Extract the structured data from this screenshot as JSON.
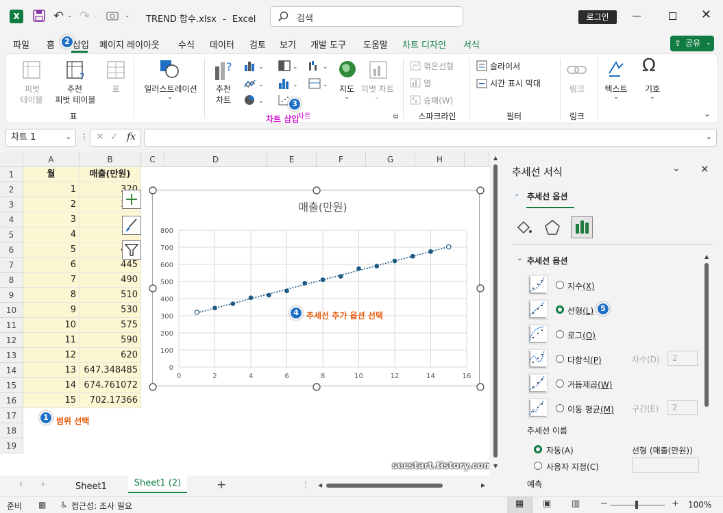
{
  "titlebar": {
    "filename": "TREND 함수.xlsx",
    "separator": "-",
    "app": "Excel",
    "search_placeholder": "검색",
    "login": "로그인"
  },
  "menu": {
    "tabs": [
      "파일",
      "홈",
      "삽입",
      "페이지 레이아웃",
      "수식",
      "데이터",
      "검토",
      "보기",
      "개발 도구",
      "도움말",
      "차트 디자인",
      "서식"
    ],
    "share": "공유"
  },
  "ribbon": {
    "pivot_table": [
      "피벗",
      "테이블"
    ],
    "recommended_pivot": [
      "추천",
      "피벗 테이블"
    ],
    "table": "표",
    "group_table": "표",
    "illustrations": "일러스트레이션",
    "recommended_chart": [
      "추천",
      "차트"
    ],
    "map": "지도",
    "pivot_chart": "피벗 차트",
    "group_chart": "차트",
    "sparkline_line": "꺾은선형",
    "sparkline_column": "열",
    "sparkline_winloss": "승패(W)",
    "group_sparkline": "스파크라인",
    "slicer": "슬라이서",
    "timeline": "시간 표시 막대",
    "group_filter": "필터",
    "link": "링크",
    "group_link": "링크",
    "text": "텍스트",
    "symbol": "기호"
  },
  "formula_bar": {
    "name_box": "차트 1",
    "fx": "fx",
    "formula": ""
  },
  "sheet": {
    "columns": [
      "A",
      "B",
      "C",
      "D",
      "E",
      "F",
      "G",
      "H"
    ],
    "rows": [
      "1",
      "2",
      "3",
      "4",
      "5",
      "6",
      "7",
      "8",
      "9",
      "10",
      "11",
      "12",
      "13",
      "14",
      "15",
      "16",
      "17",
      "18",
      "19"
    ],
    "header_a": "월",
    "header_b": "매출(만원)",
    "months": [
      "1",
      "2",
      "3",
      "4",
      "5",
      "6",
      "7",
      "8",
      "9",
      "10",
      "11",
      "12",
      "13",
      "14",
      "15"
    ],
    "sales": [
      "320",
      "345",
      "",
      "",
      "410",
      "445",
      "490",
      "510",
      "530",
      "575",
      "590",
      "620",
      "647.348485",
      "674.761072",
      "702.17366"
    ]
  },
  "chart_data": {
    "type": "scatter",
    "title": "매출(만원)",
    "x": [
      1,
      2,
      3,
      4,
      5,
      6,
      7,
      8,
      9,
      10,
      11,
      12,
      13,
      14,
      15
    ],
    "y": [
      320,
      345,
      370,
      405,
      420,
      445,
      490,
      510,
      530,
      575,
      590,
      620,
      647.35,
      674.76,
      702.17
    ],
    "xlim": [
      0,
      16
    ],
    "ylim": [
      0,
      800
    ],
    "x_ticks": [
      "0",
      "2",
      "4",
      "6",
      "8",
      "10",
      "12",
      "14",
      "16"
    ],
    "y_ticks": [
      "0",
      "100",
      "200",
      "300",
      "400",
      "500",
      "600",
      "700",
      "800"
    ],
    "trendline": "linear",
    "grid": true,
    "colors": {
      "marker": "#1f5b85",
      "trend": "#1f5b85"
    }
  },
  "annotations": {
    "a1": {
      "num": "1",
      "text": "범위 선택"
    },
    "a2": {
      "num": "2"
    },
    "a3": {
      "num": "3",
      "text": "차트 삽입"
    },
    "a4": {
      "num": "4",
      "text": "추세선 추가 옵션 선택"
    },
    "a5": {
      "num": "5"
    },
    "watermark": "secstart.tistory.com"
  },
  "pane": {
    "title": "추세선 서식",
    "tab": "추세선 옵션",
    "section": "추세선 옵션",
    "options": [
      {
        "label": "지수",
        "key": "(X)"
      },
      {
        "label": "선형",
        "key": "(L)"
      },
      {
        "label": "로그",
        "key": "(O)"
      },
      {
        "label": "다항식",
        "key": "(P)"
      },
      {
        "label": "거듭제곱",
        "key": "(W)"
      },
      {
        "label": "이동 평균",
        "key": "(M)"
      }
    ],
    "selected": "선형",
    "order_label": "차수(D)",
    "order_value": "2",
    "period_label": "구간(E)",
    "period_value": "2",
    "name_heading": "추세선 이름",
    "auto": "자동(A)",
    "auto_value": "선형 (매출(만원))",
    "custom": "사용자 지정(C)",
    "forecast": "예측"
  },
  "sheettabs": {
    "tabs": [
      "Sheet1",
      "Sheet1 (2)"
    ],
    "add": "+"
  },
  "status": {
    "ready": "준비",
    "accessibility": "접근성: 조사 필요",
    "zoom": "100%"
  },
  "colors": {
    "excel_green": "#107c41",
    "accent_blue": "#1f6fc5",
    "annotation_orange": "#e8590c",
    "annotation_magenta": "#d21ad2",
    "highlight": "#fdf6d3"
  }
}
